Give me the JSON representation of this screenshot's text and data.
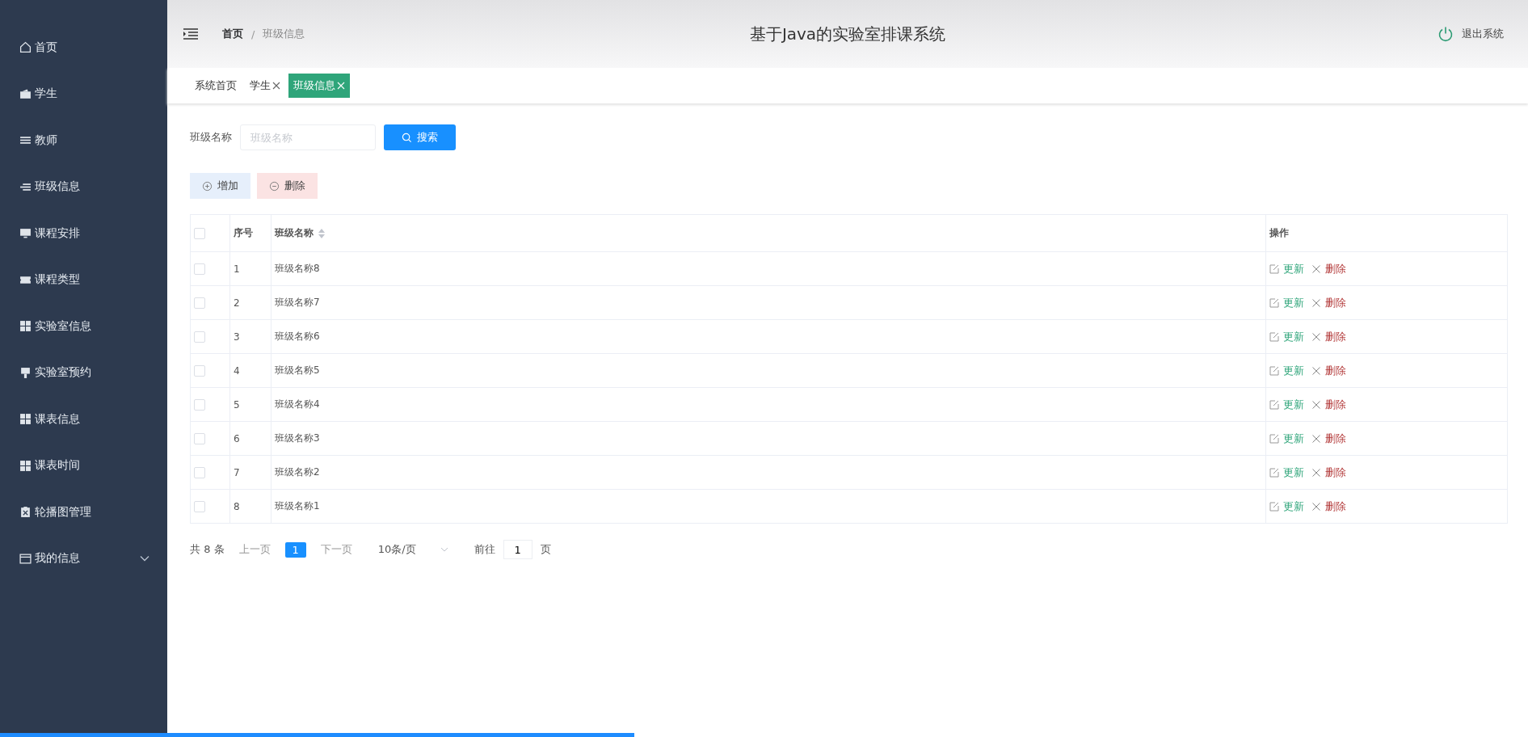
{
  "sidebar": {
    "items": [
      {
        "label": "首页",
        "expandable": false
      },
      {
        "label": "学生",
        "expandable": false
      },
      {
        "label": "教师",
        "expandable": false
      },
      {
        "label": "班级信息",
        "expandable": false
      },
      {
        "label": "课程安排",
        "expandable": false
      },
      {
        "label": "课程类型",
        "expandable": false
      },
      {
        "label": "实验室信息",
        "expandable": false
      },
      {
        "label": "实验室预约",
        "expandable": false
      },
      {
        "label": "课表信息",
        "expandable": false
      },
      {
        "label": "课表时间",
        "expandable": false
      },
      {
        "label": "轮播图管理",
        "expandable": false
      },
      {
        "label": "我的信息",
        "expandable": true
      }
    ]
  },
  "header": {
    "breadcrumb": [
      "首页",
      "班级信息"
    ],
    "breadcrumb_separator": "/",
    "title": "基于Java的实验室排课系统",
    "logout": "退出系统"
  },
  "tabs": [
    {
      "label": "系统首页",
      "closable": false,
      "selected": false
    },
    {
      "label": "学生",
      "closable": true,
      "selected": false
    },
    {
      "label": "班级信息",
      "closable": true,
      "selected": true
    }
  ],
  "search": {
    "label": "班级名称",
    "placeholder": "班级名称",
    "button": "搜索"
  },
  "actions": [
    {
      "label": "增加",
      "kind": "add"
    },
    {
      "label": "删除",
      "kind": "delete"
    }
  ],
  "table": {
    "columns": [
      "序号",
      "班级名称",
      "操作"
    ],
    "select_all_checked": false,
    "rows": [
      {
        "index": "1",
        "name": "班级名称8",
        "checked": false,
        "update": "更新",
        "delete": "删除"
      },
      {
        "index": "2",
        "name": "班级名称7",
        "checked": false,
        "update": "更新",
        "delete": "删除"
      },
      {
        "index": "3",
        "name": "班级名称6",
        "checked": false,
        "update": "更新",
        "delete": "删除"
      },
      {
        "index": "4",
        "name": "班级名称5",
        "checked": false,
        "update": "更新",
        "delete": "删除"
      },
      {
        "index": "5",
        "name": "班级名称4",
        "checked": false,
        "update": "更新",
        "delete": "删除"
      },
      {
        "index": "6",
        "name": "班级名称3",
        "checked": false,
        "update": "更新",
        "delete": "删除"
      },
      {
        "index": "7",
        "name": "班级名称2",
        "checked": false,
        "update": "更新",
        "delete": "删除"
      },
      {
        "index": "8",
        "name": "班级名称1",
        "checked": false,
        "update": "更新",
        "delete": "删除"
      }
    ]
  },
  "pagination": {
    "total": "共 8 条",
    "prev": "上一页",
    "pages": [
      {
        "label": "1",
        "selected": true
      }
    ],
    "next": "下一页",
    "page_size": "10条/页",
    "goto": "前往",
    "goto_value": "1",
    "page_unit": "页"
  },
  "video_progress": {
    "level": 0.415
  }
}
